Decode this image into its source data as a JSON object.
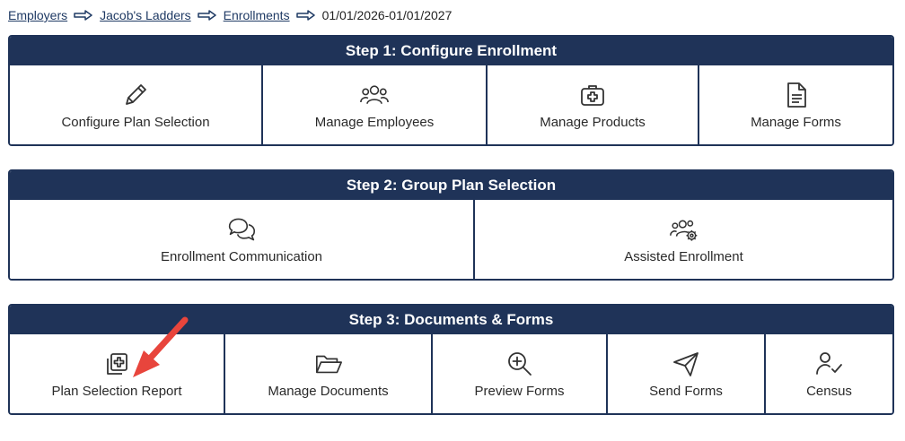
{
  "breadcrumb": {
    "items": [
      "Employers",
      "Jacob's Ladders",
      "Enrollments"
    ],
    "current": "01/01/2026-01/01/2027"
  },
  "step1": {
    "title": "Step 1: Configure Enrollment",
    "tiles": [
      {
        "label": "Configure Plan Selection",
        "icon": "pencil-icon"
      },
      {
        "label": "Manage Employees",
        "icon": "users-icon"
      },
      {
        "label": "Manage Products",
        "icon": "medical-kit-icon"
      },
      {
        "label": "Manage Forms",
        "icon": "document-icon"
      }
    ]
  },
  "step2": {
    "title": "Step 2: Group Plan Selection",
    "tiles": [
      {
        "label": "Enrollment Communication",
        "icon": "chat-bubbles-icon"
      },
      {
        "label": "Assisted Enrollment",
        "icon": "users-gear-icon"
      }
    ]
  },
  "step3": {
    "title": "Step 3: Documents & Forms",
    "tiles": [
      {
        "label": "Plan Selection Report",
        "icon": "copy-plus-icon"
      },
      {
        "label": "Manage Documents",
        "icon": "folder-open-icon"
      },
      {
        "label": "Preview Forms",
        "icon": "zoom-in-icon"
      },
      {
        "label": "Send Forms",
        "icon": "paper-plane-icon"
      },
      {
        "label": "Census",
        "icon": "user-check-icon"
      }
    ]
  },
  "colors": {
    "header_bg": "#1f3358",
    "link": "#1f3a64",
    "annotation_arrow": "#e8453c"
  }
}
